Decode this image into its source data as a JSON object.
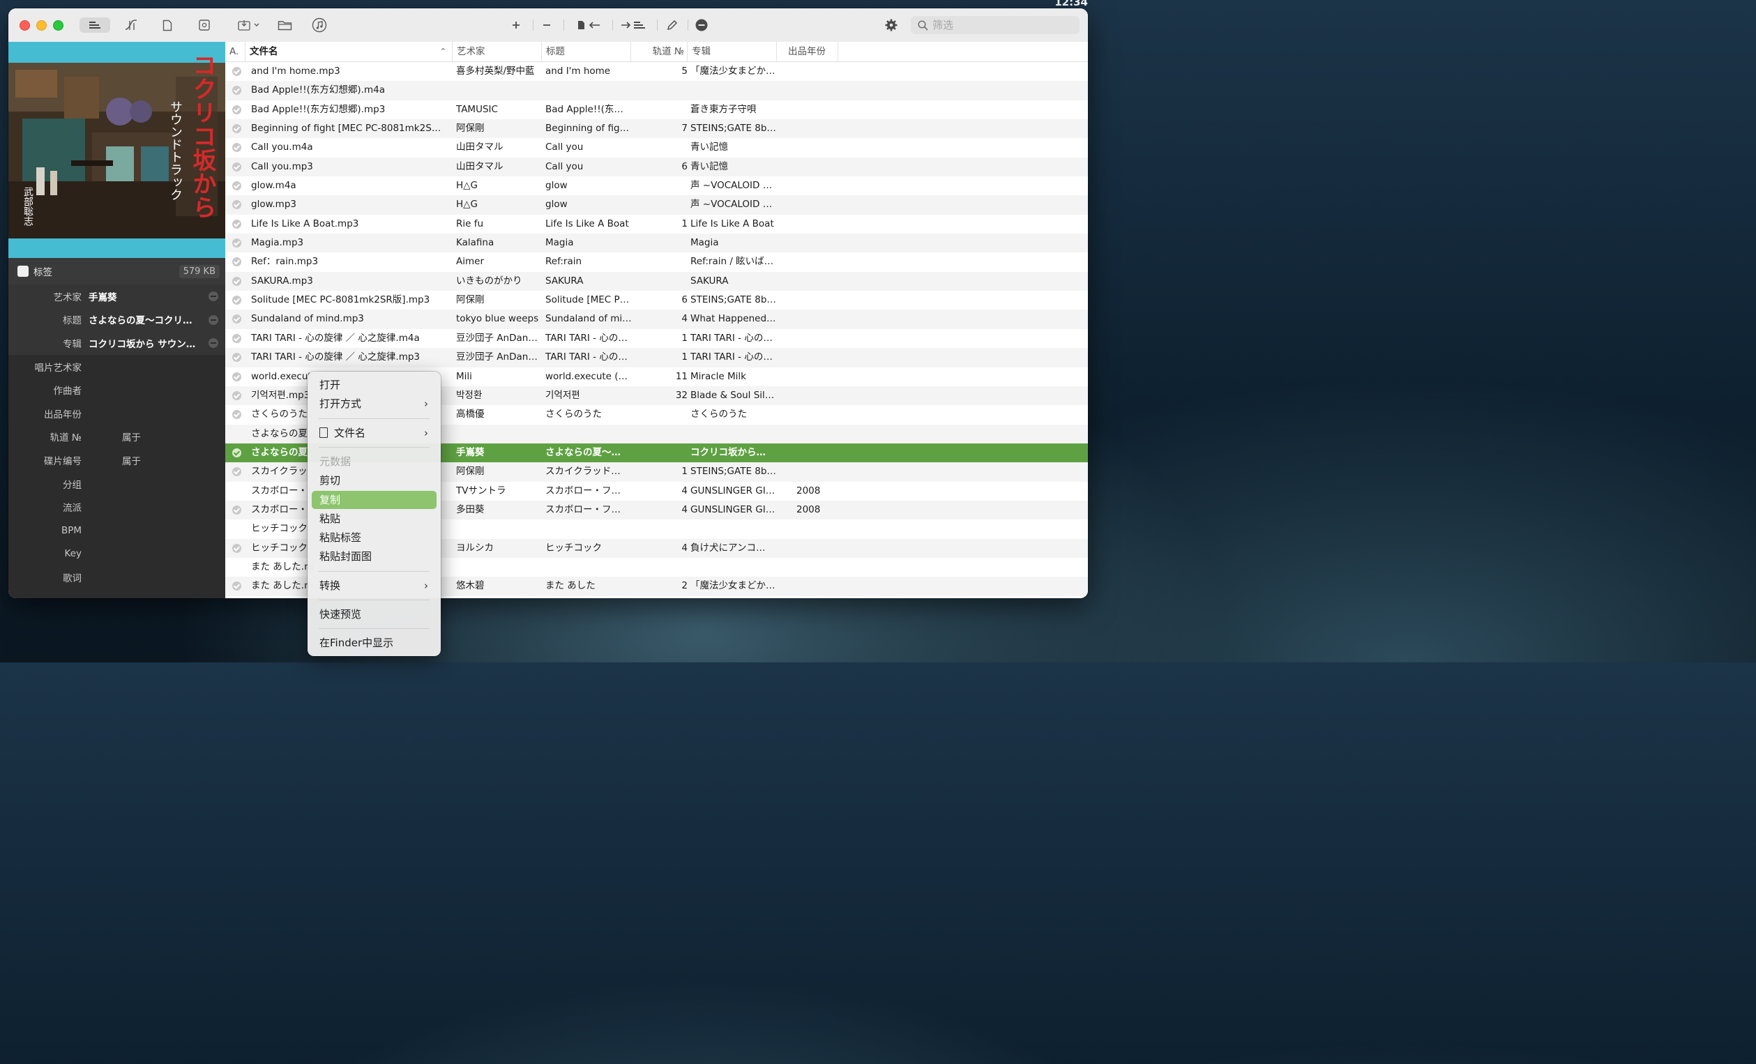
{
  "desktop": {
    "clock": "12:34"
  },
  "toolbar": {
    "buttons": [
      {
        "name": "tag-editor-icon"
      },
      {
        "name": "tag-sources-icon"
      },
      {
        "name": "file-icon"
      },
      {
        "name": "artwork-icon"
      },
      {
        "name": "export-menu-icon"
      },
      {
        "name": "folder-icon"
      },
      {
        "name": "music-icon"
      },
      {
        "name": "add-icon"
      },
      {
        "name": "remove-icon"
      },
      {
        "name": "filename-to-tag-icon"
      },
      {
        "name": "tag-to-filename-icon"
      },
      {
        "name": "edit-pencil-icon"
      },
      {
        "name": "stop-icon"
      },
      {
        "name": "settings-gear-icon"
      }
    ],
    "search_placeholder": "筛选"
  },
  "cover": {
    "title_vertical": "コクリコ坂から",
    "subtitle_vertical": "サウンドトラック",
    "composer_vertical": "武部聡志"
  },
  "tags": {
    "header_label": "标签",
    "size": "579 KB",
    "fields": [
      {
        "label": "艺术家",
        "value": "手嶌葵",
        "removable": true
      },
      {
        "label": "标题",
        "value": "さよならの夏〜コクリ…",
        "removable": true
      },
      {
        "label": "专辑",
        "value": "コクリコ坂から サウン…",
        "removable": true
      },
      {
        "label": "唱片艺术家",
        "value": ""
      },
      {
        "label": "作曲者",
        "value": ""
      },
      {
        "label": "出品年份",
        "value": ""
      },
      {
        "label": "轨道 №",
        "value": "",
        "sub": "属于"
      },
      {
        "label": "碟片编号",
        "value": "",
        "sub": "属于"
      },
      {
        "label": "分组",
        "value": ""
      },
      {
        "label": "流派",
        "value": ""
      },
      {
        "label": "BPM",
        "value": ""
      },
      {
        "label": "Key",
        "value": ""
      },
      {
        "label": "歌词",
        "value": ""
      }
    ]
  },
  "table": {
    "columns": [
      {
        "key": "a",
        "label": "A."
      },
      {
        "key": "file",
        "label": "文件名"
      },
      {
        "key": "artist",
        "label": "艺术家"
      },
      {
        "key": "title",
        "label": "标题"
      },
      {
        "key": "track",
        "label": "轨道 №"
      },
      {
        "key": "album",
        "label": "专辑"
      },
      {
        "key": "year",
        "label": "出品年份"
      }
    ],
    "rows": [
      {
        "checked": true,
        "file": "and I'm home.mp3",
        "artist": "喜多村英梨/野中藍",
        "title": "and I'm home",
        "track": "5",
        "album": "「魔法少女まどか…",
        "year": ""
      },
      {
        "checked": true,
        "file": "Bad Apple!!(东方幻想郷).m4a",
        "artist": "",
        "title": "",
        "track": "",
        "album": "",
        "year": ""
      },
      {
        "checked": true,
        "file": "Bad Apple!!(东方幻想郷).mp3",
        "artist": "TAMUSIC",
        "title": "Bad Apple!!(东方…",
        "track": "",
        "album": "蒼き東方子守唄",
        "year": ""
      },
      {
        "checked": true,
        "file": "Beginning of fight [MEC PC-8081mk2SR…",
        "artist": "阿保剛",
        "title": "Beginning of figh…",
        "track": "7",
        "album": "STEINS;GATE 8b…",
        "year": ""
      },
      {
        "checked": true,
        "file": "Call you.m4a",
        "artist": "山田タマル",
        "title": "Call you",
        "track": "",
        "album": "青い記憶",
        "year": ""
      },
      {
        "checked": true,
        "file": "Call you.mp3",
        "artist": "山田タマル",
        "title": "Call you",
        "track": "6",
        "album": "青い記憶",
        "year": ""
      },
      {
        "checked": true,
        "file": "glow.m4a",
        "artist": "H△G",
        "title": "glow",
        "track": "",
        "album": "声 ~VOCALOID C…",
        "year": ""
      },
      {
        "checked": true,
        "file": "glow.mp3",
        "artist": "H△G",
        "title": "glow",
        "track": "",
        "album": "声 ~VOCALOID C…",
        "year": ""
      },
      {
        "checked": true,
        "file": "Life Is Like A Boat.mp3",
        "artist": "Rie fu",
        "title": "Life Is Like A Boat",
        "track": "1",
        "album": "Life Is Like A Boat",
        "year": ""
      },
      {
        "checked": true,
        "file": "Magia.mp3",
        "artist": "Kalafina",
        "title": "Magia",
        "track": "",
        "album": "Magia",
        "year": ""
      },
      {
        "checked": true,
        "file": "Ref：rain.mp3",
        "artist": "Aimer",
        "title": "Ref:rain",
        "track": "",
        "album": "Ref:rain / 眩いば…",
        "year": ""
      },
      {
        "checked": true,
        "file": "SAKURA.mp3",
        "artist": "いきものがかり",
        "title": "SAKURA",
        "track": "",
        "album": "SAKURA",
        "year": ""
      },
      {
        "checked": true,
        "file": "Solitude [MEC PC-8081mk2SR版].mp3",
        "artist": "阿保剛",
        "title": "Solitude [MEC P…",
        "track": "6",
        "album": "STEINS;GATE 8b…",
        "year": ""
      },
      {
        "checked": true,
        "file": "Sundaland of mind.mp3",
        "artist": "tokyo blue weeps",
        "title": "Sundaland of mind",
        "track": "4",
        "album": "What Happened…",
        "year": ""
      },
      {
        "checked": true,
        "file": "TARI TARI - 心の旋律 ／ 心之旋律.m4a",
        "artist": "豆沙団子 AnDang…",
        "title": "TARI TARI - 心の…",
        "track": "1",
        "album": "TARI TARI - 心の…",
        "year": ""
      },
      {
        "checked": true,
        "file": "TARI TARI - 心の旋律 ／ 心之旋律.mp3",
        "artist": "豆沙団子 AnDang…",
        "title": "TARI TARI - 心の…",
        "track": "1",
        "album": "TARI TARI - 心の…",
        "year": ""
      },
      {
        "checked": true,
        "file": "world.execut",
        "artist": "Mili",
        "title": "world.execute (…",
        "track": "11",
        "album": "Miracle Milk",
        "year": ""
      },
      {
        "checked": true,
        "file": "기억저편.mp3",
        "artist": "박정환",
        "title": "기억저편",
        "track": "32",
        "album": "Blade & Soul Silv…",
        "year": ""
      },
      {
        "checked": true,
        "file": "さくらのうた",
        "artist": "高橋優",
        "title": "さくらのうた",
        "track": "",
        "album": "さくらのうた",
        "year": ""
      },
      {
        "checked": false,
        "file": "さよならの夏",
        "artist": "",
        "title": "",
        "track": "",
        "album": "",
        "year": ""
      },
      {
        "checked": true,
        "selected": true,
        "file": "さよならの夏",
        "artist": "手嶌葵",
        "title": "さよならの夏〜…",
        "track": "",
        "album": "コクリコ坂から…",
        "year": ""
      },
      {
        "checked": true,
        "file": "スカイクラッ",
        "artist": "阿保剛",
        "title": "スカイクラッド…",
        "track": "1",
        "album": "STEINS;GATE 8b…",
        "year": ""
      },
      {
        "checked": false,
        "file": "スカボロー・",
        "artist": "TVサントラ",
        "title": "スカボロー・フ…",
        "track": "4",
        "album": "GUNSLINGER GI…",
        "year": "2008"
      },
      {
        "checked": true,
        "file": "スカボロー・",
        "artist": "多田葵",
        "title": "スカボロー・フ…",
        "track": "4",
        "album": "GUNSLINGER GI…",
        "year": "2008"
      },
      {
        "checked": false,
        "file": "ヒッチコック",
        "artist": "",
        "title": "",
        "track": "",
        "album": "",
        "year": ""
      },
      {
        "checked": true,
        "file": "ヒッチコック",
        "artist": "ヨルシカ",
        "title": "ヒッチコック",
        "track": "4",
        "album": "負け犬にアンコ…",
        "year": ""
      },
      {
        "checked": false,
        "file": "また あした.m",
        "artist": "",
        "title": "",
        "track": "",
        "album": "",
        "year": ""
      },
      {
        "checked": true,
        "file": "また あした.m",
        "artist": "悠木碧",
        "title": "また あした",
        "track": "2",
        "album": "「魔法少女まどか…",
        "year": ""
      }
    ]
  },
  "context_menu": {
    "items": [
      {
        "label": "打开",
        "type": "item"
      },
      {
        "label": "打开方式",
        "type": "submenu"
      },
      {
        "type": "sep"
      },
      {
        "label": "文件名",
        "type": "submenu",
        "icon": "file-icon"
      },
      {
        "type": "sep"
      },
      {
        "label": "元数据",
        "type": "header"
      },
      {
        "label": "剪切",
        "type": "item"
      },
      {
        "label": "复制",
        "type": "item",
        "highlighted": true
      },
      {
        "label": "粘贴",
        "type": "item"
      },
      {
        "label": "粘贴标签",
        "type": "item"
      },
      {
        "label": "粘贴封面图",
        "type": "item"
      },
      {
        "type": "sep"
      },
      {
        "label": "转换",
        "type": "submenu"
      },
      {
        "type": "sep"
      },
      {
        "label": "快速预览",
        "type": "item"
      },
      {
        "type": "sep"
      },
      {
        "label": "在Finder中显示",
        "type": "item"
      }
    ]
  }
}
